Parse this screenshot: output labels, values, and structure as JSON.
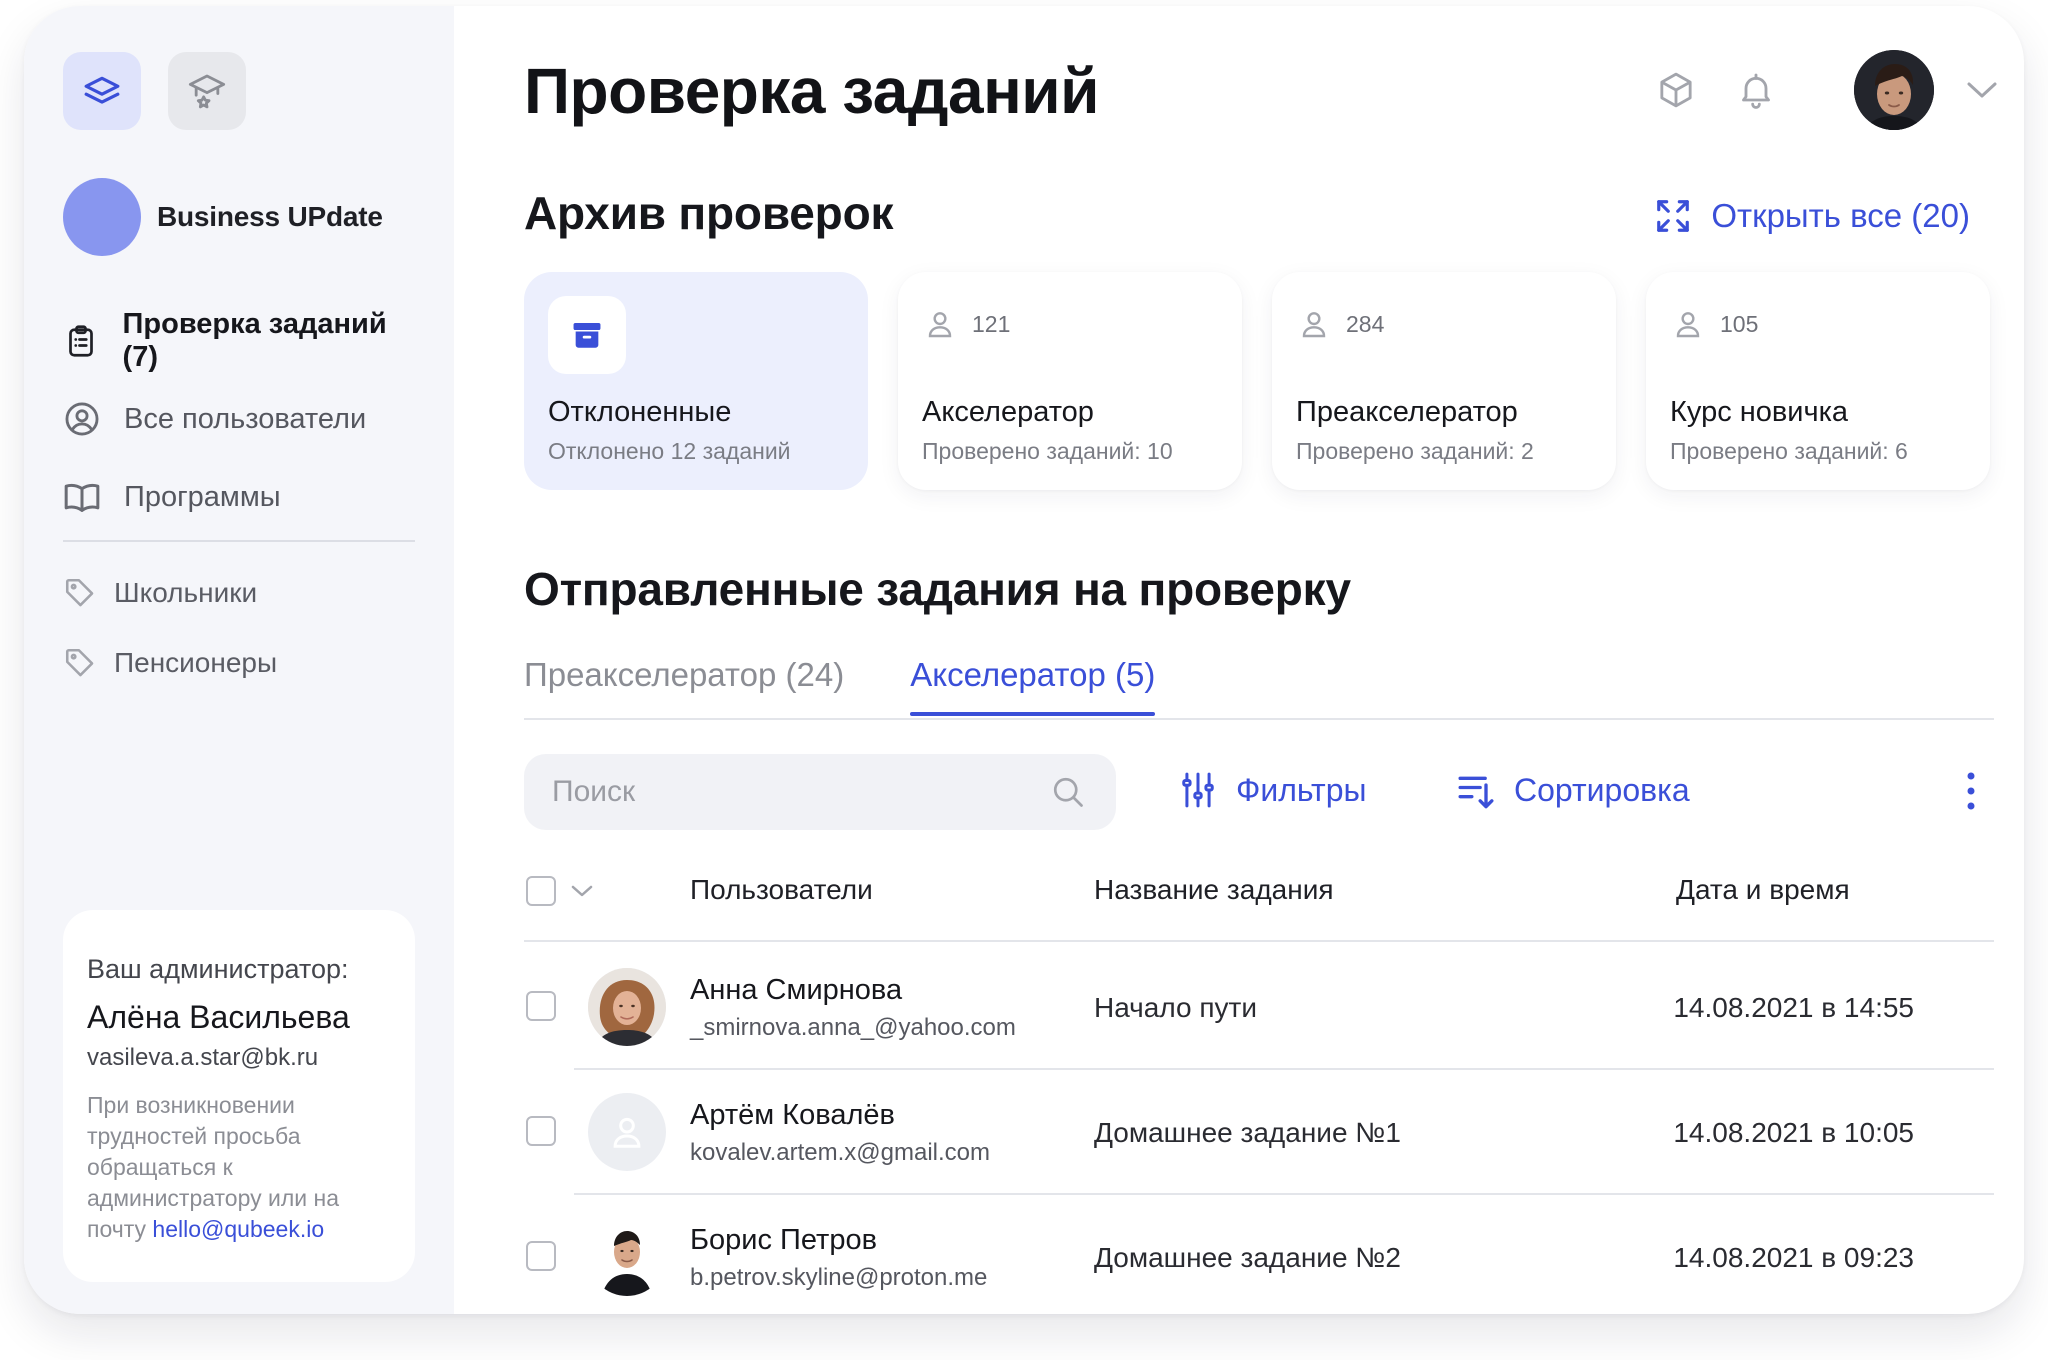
{
  "colors": {
    "accent": "#3a4fd8",
    "sidebar_bg": "#f5f6fa",
    "active_card_bg": "#eceffd",
    "org_logo": "#8896ef"
  },
  "sidebar": {
    "app_switcher": [
      {
        "icon": "graduation-cap-icon",
        "active": true
      },
      {
        "icon": "graduation-cap-star-icon",
        "active": false
      }
    ],
    "org_name": "Business UPdate",
    "nav": [
      {
        "icon": "clipboard-icon",
        "label": "Проверка заданий (7)",
        "current": true
      },
      {
        "icon": "user-circle-icon",
        "label": "Все пользователи",
        "current": false
      },
      {
        "icon": "book-open-icon",
        "label": "Программы",
        "current": false
      }
    ],
    "tags": [
      {
        "icon": "tag-icon",
        "label": "Школьники"
      },
      {
        "icon": "tag-icon",
        "label": "Пенсионеры"
      }
    ],
    "admin": {
      "label": "Ваш администратор:",
      "name": "Алёна Васильева",
      "email": "vasileva.a.star@bk.ru",
      "note": "При возникновении трудностей просьба обращаться к администратору или на почту",
      "link": "hello@qubeek.io"
    }
  },
  "header": {
    "title": "Проверка заданий",
    "icons": [
      "cube-icon",
      "bell-icon",
      "chevron-down-icon"
    ]
  },
  "archive": {
    "title": "Архив проверок",
    "open_all": "Открыть все (20)",
    "cards": [
      {
        "type": "rejected",
        "title": "Отклоненные",
        "subtitle": "Отклонено 12 заданий",
        "active": true
      },
      {
        "type": "program",
        "count": "121",
        "title": "Акселератор",
        "subtitle": "Проверено заданий: 10"
      },
      {
        "type": "program",
        "count": "284",
        "title": "Преакселератор",
        "subtitle": "Проверено заданий: 2"
      },
      {
        "type": "program",
        "count": "105",
        "title": "Курс новичка",
        "subtitle": "Проверено заданий: 6"
      }
    ]
  },
  "submitted": {
    "title": "Отправленные задания на проверку",
    "tabs": [
      {
        "label": "Преакселератор (24)",
        "active": false
      },
      {
        "label": "Акселератор (5)",
        "active": true
      }
    ],
    "search_placeholder": "Поиск",
    "filters": "Фильтры",
    "sort": "Сортировка",
    "columns": [
      "Пользователи",
      "Название задания",
      "Дата и время"
    ],
    "rows": [
      {
        "name": "Анна Смирнова",
        "email": "_smirnova.anna_@yahoo.com",
        "task": "Начало пути",
        "date": "14.08.2021 в 14:55",
        "avatar": "photo-female"
      },
      {
        "name": "Артём Ковалёв",
        "email": "kovalev.artem.x@gmail.com",
        "task": "Домашнее задание №1",
        "date": "14.08.2021 в 10:05",
        "avatar": "placeholder"
      },
      {
        "name": "Борис Петров",
        "email": "b.petrov.skyline@proton.me",
        "task": "Домашнее задание №2",
        "date": "14.08.2021 в 09:23",
        "avatar": "photo-male"
      }
    ]
  }
}
